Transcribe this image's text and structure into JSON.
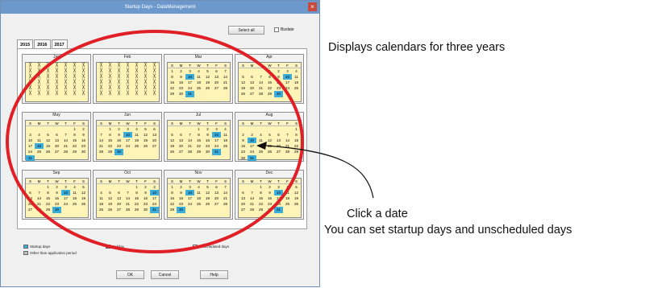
{
  "window": {
    "title": "Startup Days - DataManagement",
    "select_all_label": "Select all",
    "bizdate_label": "Bizdate"
  },
  "tabs": [
    "2015",
    "2016",
    "2017"
  ],
  "months": [
    {
      "name": "Jan",
      "crossed": true,
      "offset": 4,
      "days": 31,
      "selected": []
    },
    {
      "name": "Feb",
      "crossed": true,
      "offset": 0,
      "days": 28,
      "selected": []
    },
    {
      "name": "Mar",
      "crossed": false,
      "offset": 0,
      "days": 31,
      "selected": [
        10,
        31
      ]
    },
    {
      "name": "Apr",
      "crossed": false,
      "offset": 3,
      "days": 30,
      "selected": [
        10,
        30
      ]
    },
    {
      "name": "May",
      "crossed": false,
      "offset": 5,
      "days": 31,
      "selected": [
        18,
        31
      ]
    },
    {
      "name": "Jun",
      "crossed": false,
      "offset": 1,
      "days": 30,
      "selected": [
        10,
        30
      ]
    },
    {
      "name": "Jul",
      "crossed": false,
      "offset": 3,
      "days": 31,
      "selected": [
        10,
        31
      ]
    },
    {
      "name": "Aug",
      "crossed": false,
      "offset": 6,
      "days": 31,
      "selected": [
        10,
        31
      ]
    },
    {
      "name": "Sep",
      "crossed": false,
      "offset": 2,
      "days": 30,
      "selected": [
        10,
        30
      ]
    },
    {
      "name": "Oct",
      "crossed": false,
      "offset": 4,
      "days": 31,
      "selected": [
        10,
        31
      ]
    },
    {
      "name": "Nov",
      "crossed": false,
      "offset": 0,
      "days": 30,
      "selected": [
        10,
        30
      ]
    },
    {
      "name": "Dec",
      "crossed": false,
      "offset": 2,
      "days": 31,
      "selected": [
        10,
        31
      ]
    }
  ],
  "weekdays": [
    "S",
    "M",
    "T",
    "W",
    "T",
    "F",
    "S"
  ],
  "legend": {
    "startup": "Startup days",
    "other": "Other than application period",
    "holiday": "Holiday",
    "unscheduled": "Unscheduled days",
    "colors": {
      "startup": "#3aaed8",
      "other": "#c0c0c0",
      "holiday": "#c0392b",
      "unscheduled": "#f4f4f4"
    }
  },
  "buttons": {
    "ok": "OK",
    "cancel": "Cancel",
    "help": "Help"
  },
  "annotations": {
    "top": "Displays calendars for three years",
    "line1": "Click a date",
    "line2": "You can set startup days and unscheduled days"
  },
  "colors": {
    "highlight_ellipse": "#e02026",
    "selected_day": "#3aaed8",
    "calendar_bg": "#fff4b8"
  }
}
